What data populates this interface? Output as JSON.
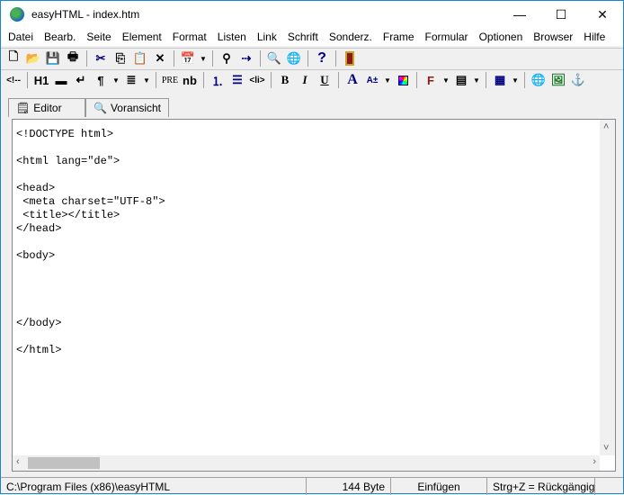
{
  "window": {
    "title": "easyHTML - index.htm"
  },
  "menu": [
    "Datei",
    "Bearb.",
    "Seite",
    "Element",
    "Format",
    "Listen",
    "Link",
    "Schrift",
    "Sonderz.",
    "Frame",
    "Formular",
    "Optionen",
    "Browser",
    "Hilfe"
  ],
  "toolbar1": [
    "new-icon",
    "open-icon",
    "save-icon",
    "print-icon",
    "|",
    "cut-icon",
    "copy-icon",
    "paste-icon",
    "delete-icon",
    "|",
    "date-icon",
    "v",
    "|",
    "find-icon",
    "replace-icon",
    "|",
    "preview-icon",
    "browser-icon",
    "|",
    "help-icon",
    "|",
    "exit-icon"
  ],
  "toolbar2": {
    "comment": "<!--",
    "h1": "H1",
    "pre": "PRE",
    "nb": "nb",
    "li": "<li>",
    "bold": "B",
    "italic": "I",
    "underline": "U",
    "font": "A",
    "fontsize": "A±"
  },
  "tabs": [
    {
      "label": "Editor",
      "active": true
    },
    {
      "label": "Voransicht",
      "active": false
    }
  ],
  "editor": {
    "lines": [
      "<!DOCTYPE html>",
      "",
      "<html lang=\"de\">",
      "",
      "<head>",
      " <meta charset=\"UTF-8\">",
      " <title></title>",
      "</head>",
      "",
      "<body>",
      "",
      "",
      "",
      "",
      "</body>",
      "",
      "</html>"
    ]
  },
  "status": {
    "path": "C:\\Program Files (x86)\\easyHTML",
    "size": "144 Byte",
    "mode": "Einfügen",
    "hint": "Strg+Z = Rückgängig"
  }
}
